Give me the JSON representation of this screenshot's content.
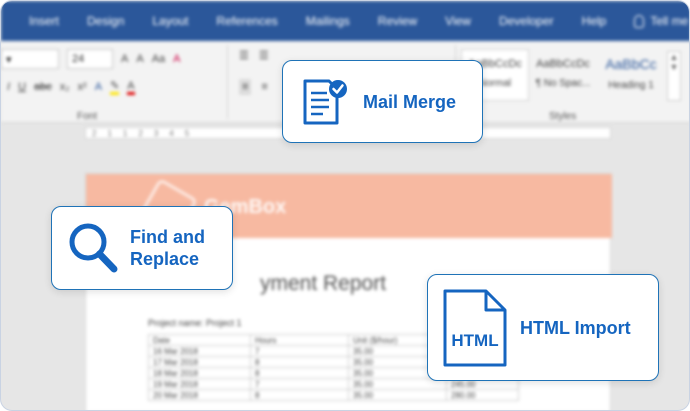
{
  "ribbon": {
    "tabs": [
      "Insert",
      "Design",
      "Layout",
      "References",
      "Mailings",
      "Review",
      "View",
      "Developer",
      "Help"
    ],
    "tell_me": "Tell me",
    "font_size": "24",
    "font_group_label": "Font",
    "styles_group_label": "Styles",
    "styles": [
      {
        "sample": "AaBbCcDc",
        "name": "Normal"
      },
      {
        "sample": "AaBbCcDc",
        "name": "¶ No Spac..."
      },
      {
        "sample": "AaBbCc",
        "name": "Heading 1"
      }
    ]
  },
  "ruler_marks": [
    "2",
    "1",
    "1",
    "2",
    "3",
    "4",
    "5",
    "14",
    "15",
    "17",
    "18"
  ],
  "document": {
    "brand": "GemBox",
    "title": "yment Report",
    "project_label": "Project name: Project 1",
    "table": {
      "headers": [
        "Date",
        "Hours",
        "Unit ($/hour)",
        ""
      ],
      "rows": [
        [
          "16 Mar 2018",
          "7",
          "35.00",
          ""
        ],
        [
          "17 Mar 2018",
          "8",
          "35.00",
          ""
        ],
        [
          "18 Mar 2018",
          "8",
          "35.00",
          ""
        ],
        [
          "19 Mar 2018",
          "7",
          "35.00",
          "245.00"
        ],
        [
          "20 Mar 2018",
          "8",
          "35.00",
          "280.00"
        ]
      ]
    }
  },
  "features": {
    "mail_merge": "Mail Merge",
    "find_replace_line1": "Find and",
    "find_replace_line2": "Replace",
    "html_import": "HTML Import",
    "html_badge": "HTML"
  },
  "colors": {
    "ribbon": "#2b579a",
    "accent": "#1565c0",
    "banner": "#f7b9a1"
  }
}
